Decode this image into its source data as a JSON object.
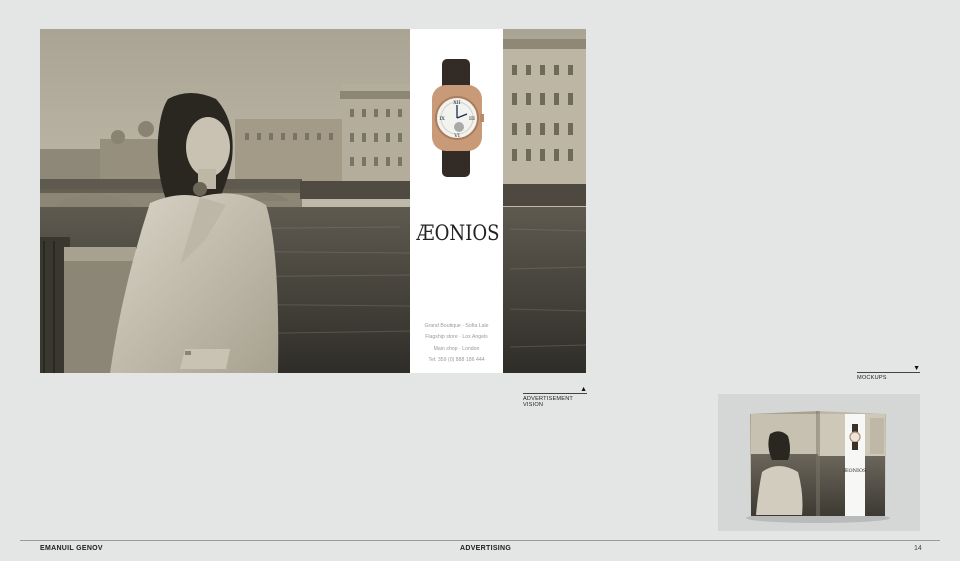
{
  "advertisement": {
    "brand": "ÆONIOS",
    "stores": [
      "Grand Boutique · Sofia Lale",
      "Flagship store · Los Angels",
      "Main shop · London",
      "Tel: 359 (0) 888 186 444"
    ]
  },
  "captions": {
    "advertisement_line1": "ADVERTISEMENT",
    "advertisement_line2": "VISION",
    "advertisement_arrow": "▲",
    "mockups": "MOCKUPS",
    "mockups_arrow": "▼"
  },
  "mockup": {
    "brand": "ÆONIOS"
  },
  "footer": {
    "author": "EMANUIL GENOV",
    "section": "ADVERTISING",
    "page_number": "14"
  },
  "colors": {
    "page_background": "#e4e5e5",
    "panel_white": "#ffffff",
    "text_dark": "#1d1d1d",
    "store_text": "#9a9a9a"
  }
}
